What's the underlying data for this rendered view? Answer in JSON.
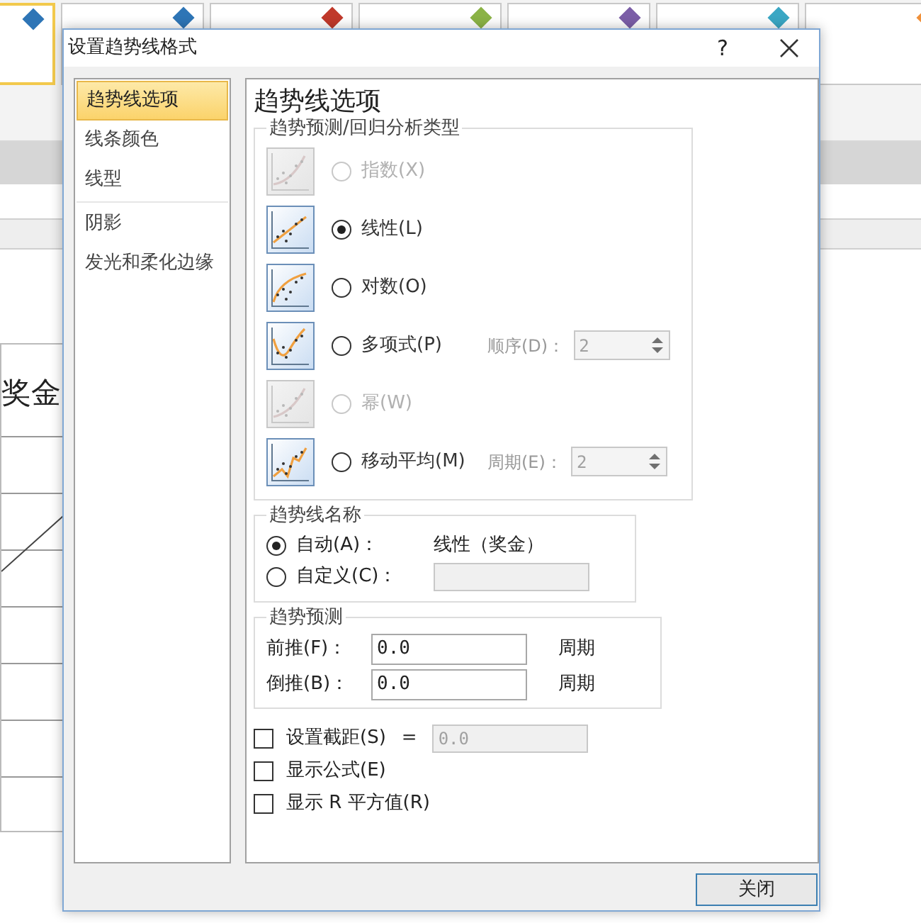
{
  "background": {
    "thumbnails": [
      {
        "color": "#2e75b6",
        "selected": true
      },
      {
        "color": "#2e75b6",
        "selected": false
      },
      {
        "color": "#c0392b",
        "selected": false
      },
      {
        "color": "#8bb346",
        "selected": false
      },
      {
        "color": "#7b5ea7",
        "selected": false
      },
      {
        "color": "#3aa7c4",
        "selected": false
      },
      {
        "color": "#f0903a",
        "selected": false
      }
    ],
    "chart_title": "奖金"
  },
  "dialog": {
    "title": "设置趋势线格式",
    "help": "?",
    "nav_groups": [
      {
        "items": [
          {
            "label": "趋势线选项",
            "selected": true
          },
          {
            "label": "线条颜色",
            "selected": false
          },
          {
            "label": "线型",
            "selected": false
          }
        ]
      },
      {
        "items": [
          {
            "label": "阴影",
            "selected": false
          },
          {
            "label": "发光和柔化边缘",
            "selected": false
          }
        ]
      }
    ],
    "heading": "趋势线选项",
    "regression": {
      "legend": "趋势预测/回归分析类型",
      "options": [
        {
          "kind": "exponential",
          "label": "指数(X)",
          "selected": false,
          "disabled": true
        },
        {
          "kind": "linear",
          "label": "线性(L)",
          "selected": true,
          "disabled": false
        },
        {
          "kind": "logarithmic",
          "label": "对数(O)",
          "selected": false,
          "disabled": false
        },
        {
          "kind": "polynomial",
          "label": "多项式(P)",
          "selected": false,
          "disabled": false,
          "param_label": "顺序(D)：",
          "param_value": "2"
        },
        {
          "kind": "power",
          "label": "幂(W)",
          "selected": false,
          "disabled": true
        },
        {
          "kind": "moving_average",
          "label": "移动平均(M)",
          "selected": false,
          "disabled": false,
          "param_label": "周期(E)：",
          "param_value": "2"
        }
      ]
    },
    "name_group": {
      "legend": "趋势线名称",
      "options": [
        {
          "kind": "text",
          "label": "自动(A)：",
          "selected": true,
          "value": "线性（奖金）"
        },
        {
          "kind": "input",
          "label": "自定义(C)：",
          "selected": false
        }
      ]
    },
    "forecast": {
      "legend": "趋势预测",
      "rows": [
        {
          "label": "前推(F)：",
          "value": "0.0",
          "unit": "周期"
        },
        {
          "label": "倒推(B)：",
          "value": "0.0",
          "unit": "周期"
        }
      ]
    },
    "checkboxes": [
      {
        "label": "设置截距(S)",
        "checked": false,
        "sign": "=",
        "value": "0.0"
      },
      {
        "label": "显示公式(E)",
        "checked": false
      },
      {
        "label": "显示 R 平方值(R)",
        "checked": false
      }
    ],
    "close_button": "关闭"
  }
}
